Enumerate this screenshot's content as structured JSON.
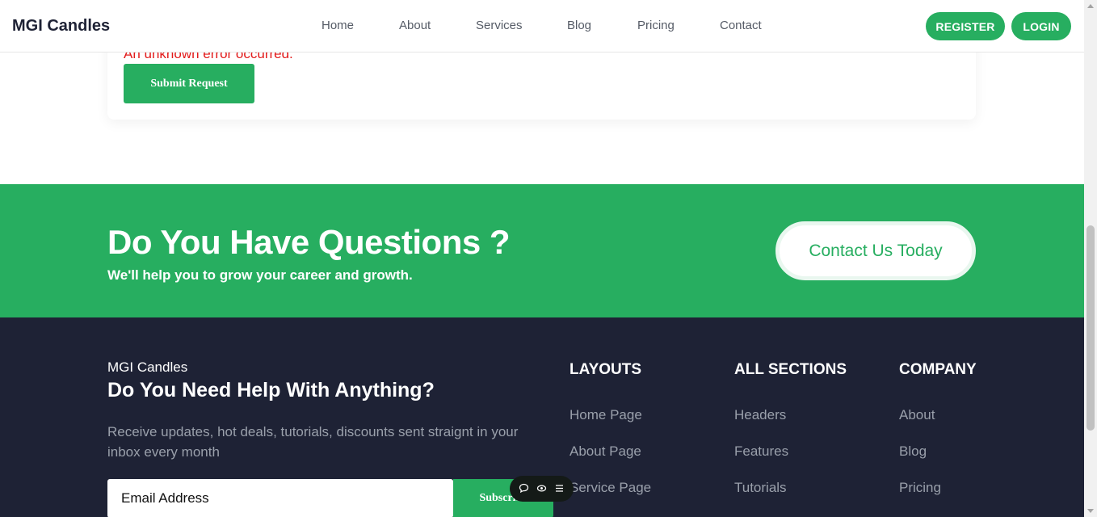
{
  "header": {
    "brand": "MGI Candles",
    "nav": [
      "Home",
      "About",
      "Services",
      "Blog",
      "Pricing",
      "Contact"
    ],
    "register_label": "REGISTER",
    "login_label": "LOGIN"
  },
  "form": {
    "error_text": "An unknown error occurred.",
    "submit_label": "Submit Request"
  },
  "cta": {
    "title": "Do You Have Questions ?",
    "subtitle": "We'll help you to grow your career and growth.",
    "button_label": "Contact Us Today"
  },
  "footer": {
    "brand": "MGI Candles",
    "heading": "Do You Need Help With Anything?",
    "description": "Receive updates, hot deals, tutorials, discounts sent straignt in your inbox every month",
    "email_placeholder": "Email Address",
    "subscribe_label": "Subscribe",
    "columns": [
      {
        "title": "LAYOUTS",
        "links": [
          "Home Page",
          "About Page",
          "Service Page"
        ]
      },
      {
        "title": "ALL SECTIONS",
        "links": [
          "Headers",
          "Features",
          "Tutorials"
        ]
      },
      {
        "title": "COMPANY",
        "links": [
          "About",
          "Blog",
          "Pricing"
        ]
      }
    ]
  },
  "float_toolbar": {
    "icons": [
      "comment-icon",
      "eye-icon",
      "menu-icon"
    ]
  },
  "colors": {
    "accent": "#27ae60",
    "footer_bg": "#1e2235",
    "error": "#e21b1b"
  }
}
